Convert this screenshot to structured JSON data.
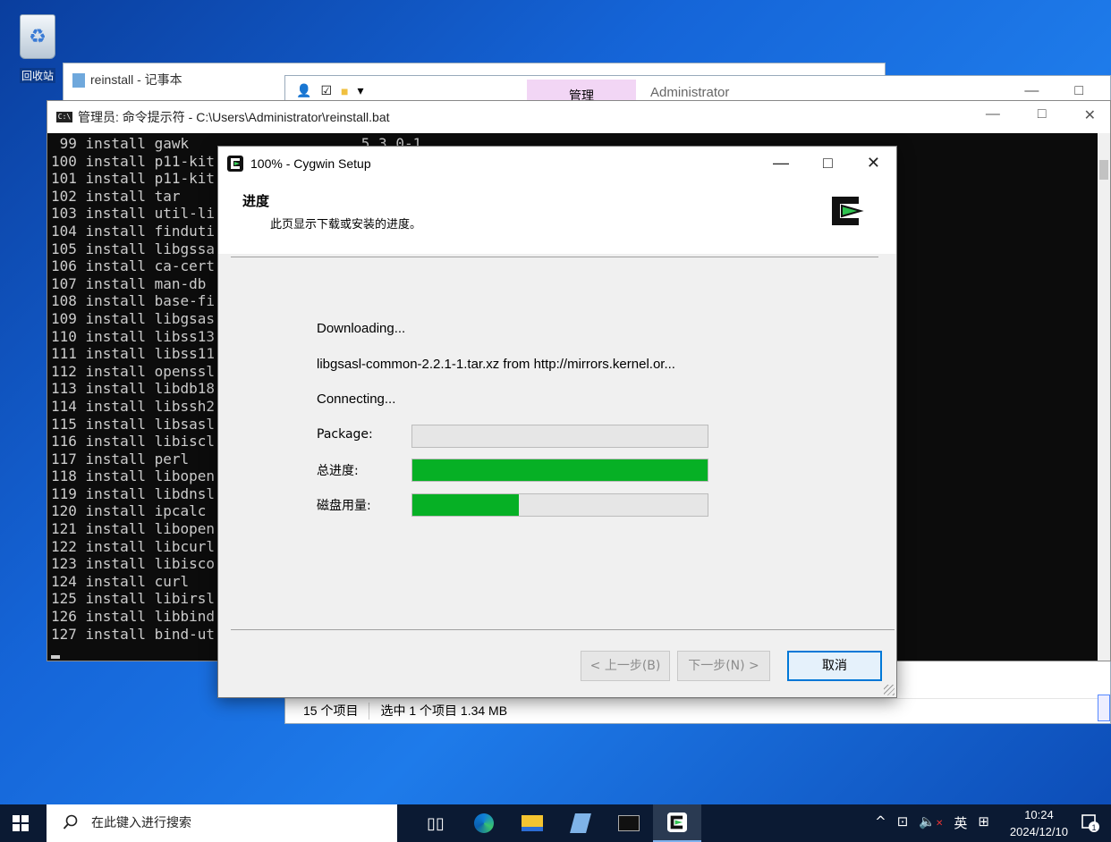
{
  "desktop": {
    "recycle_bin_label": "回收站"
  },
  "notepad": {
    "title": "reinstall - 记事本",
    "controls": [
      "—",
      "□"
    ]
  },
  "explorer": {
    "tab_manage": "管理",
    "location": "Administrator",
    "controls": [
      "—",
      "□"
    ],
    "status_items": "15 个项目",
    "status_selected": "选中 1 个项目  1.34 MB"
  },
  "cmd": {
    "title": "管理员: 命令提示符 - C:\\Users\\Administrator\\reinstall.bat",
    "controls": [
      "—",
      "□",
      "✕"
    ],
    "lines": [
      " 99 install gawk                    5.3.0-1",
      "100 install p11-kit",
      "101 install p11-kit",
      "102 install tar",
      "103 install util-li",
      "104 install finduti",
      "105 install libgssa",
      "106 install ca-cert",
      "107 install man-db",
      "108 install base-fi",
      "109 install libgsas",
      "110 install libss13",
      "111 install libss11",
      "112 install openssl",
      "113 install libdb18",
      "114 install libssh2",
      "115 install libsasl",
      "116 install libiscl",
      "117 install perl",
      "118 install libopen",
      "119 install libdnsl",
      "120 install ipcalc",
      "121 install libopen",
      "122 install libcurl",
      "123 install libisco",
      "124 install curl",
      "125 install libirsl",
      "126 install libbind",
      "127 install bind-ut"
    ]
  },
  "setup": {
    "title": "100% - Cygwin Setup",
    "controls": [
      "—",
      "□",
      "✕"
    ],
    "header_title": "进度",
    "header_subtitle": "此页显示下载或安装的进度。",
    "status_line1": "Downloading...",
    "status_line2": "libgsasl-common-2.2.1-1.tar.xz from http://mirrors.kernel.or...",
    "status_line3": "Connecting...",
    "progress": [
      {
        "label": "Package:",
        "value": 0.0
      },
      {
        "label": "总进度:",
        "value": 1.0
      },
      {
        "label": "磁盘用量:",
        "value": 0.36
      }
    ],
    "back_button": "< 上一步(B)",
    "next_button": "下一步(N) >",
    "cancel_button": "取消",
    "accent_color": "#06b025"
  },
  "taskbar": {
    "search_placeholder": "在此键入进行搜索",
    "apps": [
      "task-view-icon",
      "edge-icon",
      "file-explorer-icon",
      "notepad-icon",
      "cmd-icon",
      "cygwin-icon"
    ],
    "tray": [
      "^",
      "网",
      "🔇",
      "英",
      "拼"
    ],
    "ime_lang": "英",
    "time": "10:24",
    "date": "2024/12/10",
    "notification_count": "1"
  }
}
